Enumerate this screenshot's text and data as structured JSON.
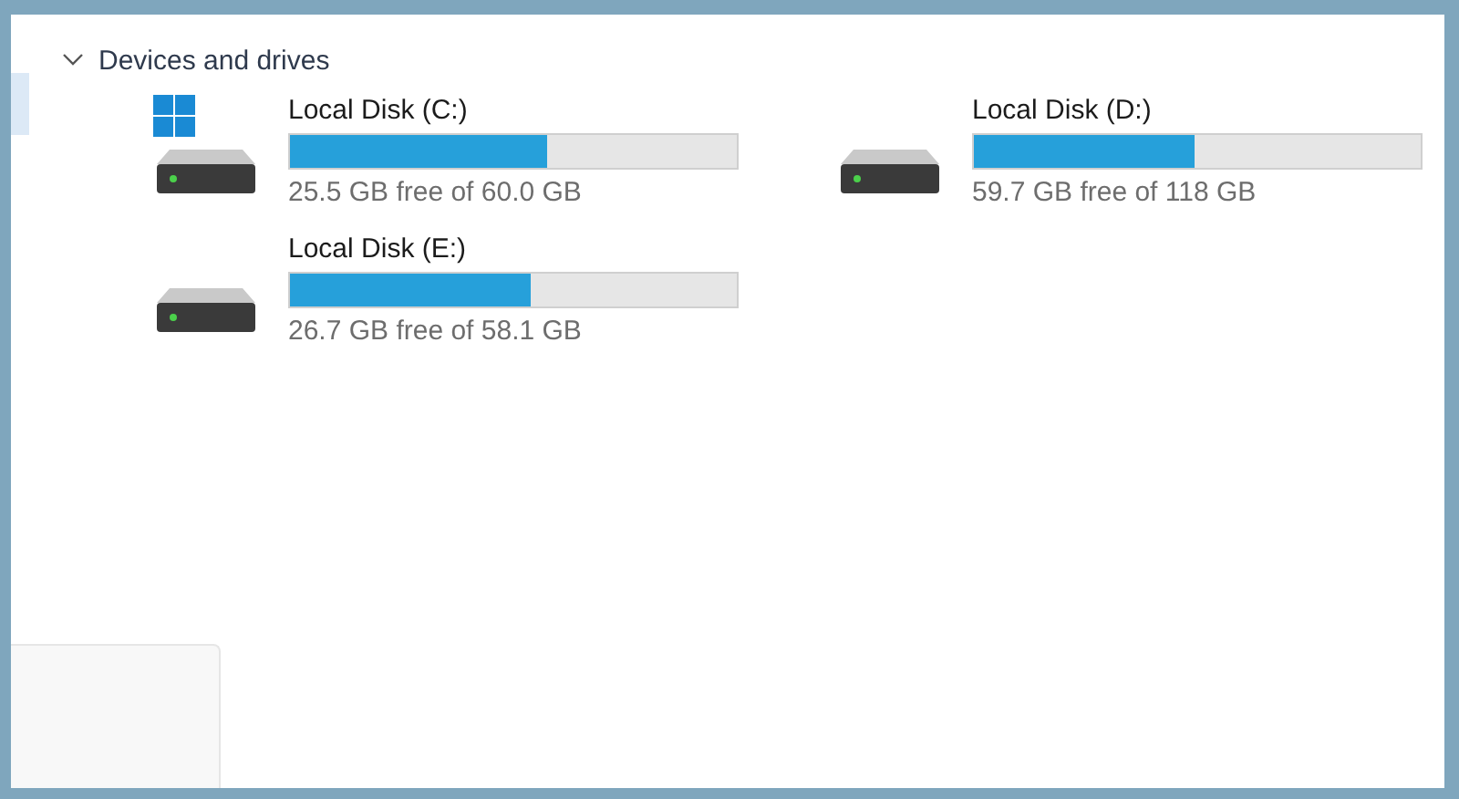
{
  "section": {
    "title": "Devices and drives",
    "expanded": true
  },
  "drives": [
    {
      "name": "Local Disk (C:)",
      "level": 0.575,
      "space": "25.5 GB free of 60.0 GB",
      "system": true
    },
    {
      "name": "Local Disk (D:)",
      "level": 0.494,
      "space": "59.7 GB free of 118 GB",
      "system": false
    },
    {
      "name": "Local Disk (E:)",
      "level": 0.54,
      "space": "26.7 GB free of 58.1 GB",
      "system": false
    }
  ]
}
